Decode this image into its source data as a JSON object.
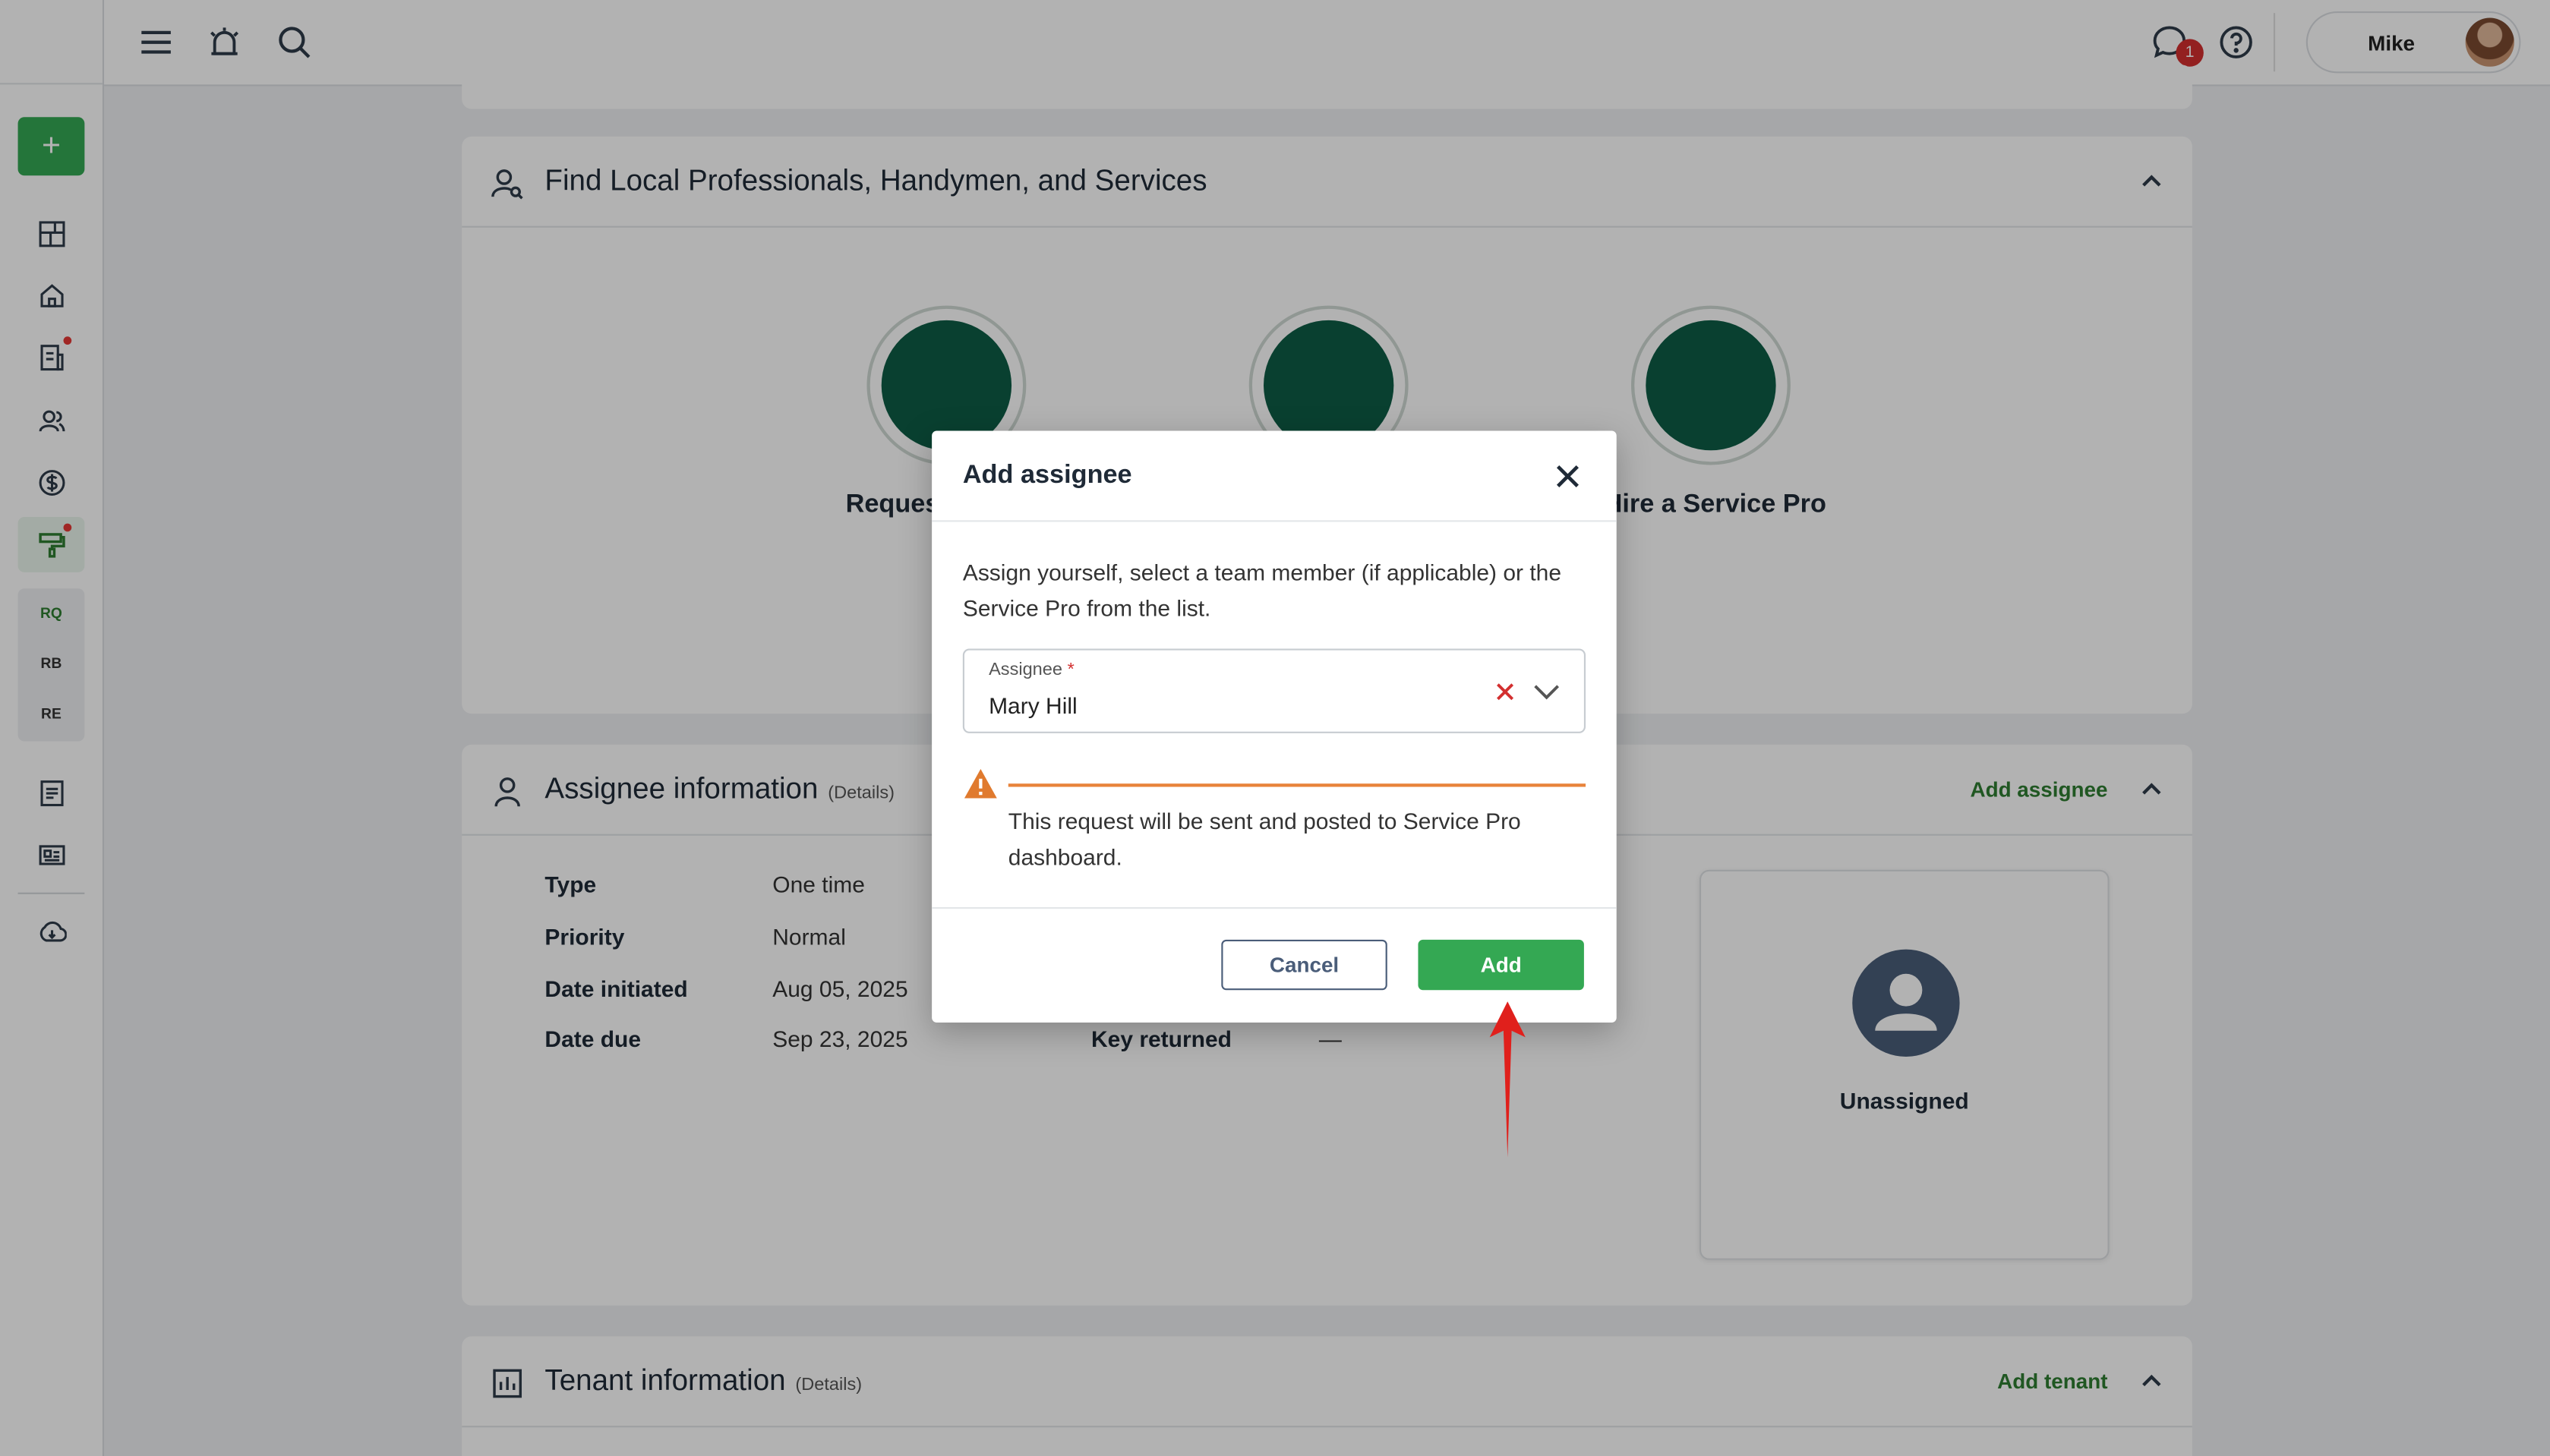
{
  "topbar": {
    "message_count": "1",
    "user_name": "Mike"
  },
  "sidebar": {
    "new_label": "+",
    "sub_items": [
      "RQ",
      "RB",
      "RE"
    ]
  },
  "find_pros": {
    "title": "Find Local Professionals, Handymen, and Services",
    "tile_left_label": "Reques",
    "tile_right_label": "Hire a Service Pro"
  },
  "assignee_info": {
    "title": "Assignee information",
    "details": "(Details)",
    "action": "Add assignee",
    "rows": [
      {
        "key": "Type",
        "value": "One time"
      },
      {
        "key": "Priority",
        "value": "Normal"
      },
      {
        "key": "Date initiated",
        "value": "Aug 05, 2025"
      },
      {
        "key": "Date due",
        "value": "Sep 23, 2025"
      }
    ],
    "key_returned_label": "Key returned",
    "key_returned_value": "—",
    "unassigned_label": "Unassigned"
  },
  "tenant_info": {
    "title": "Tenant information",
    "details": "(Details)",
    "action": "Add tenant"
  },
  "modal": {
    "title": "Add assignee",
    "description": "Assign yourself, select a team member (if applicable) or the Service Pro from the list.",
    "field_label": "Assignee",
    "field_required_mark": "*",
    "field_value": "Mary Hill",
    "warning": "This request will be sent and posted to Service Pro dashboard.",
    "cancel_label": "Cancel",
    "add_label": "Add"
  },
  "colors": {
    "accent_green": "#34a853",
    "text_green": "#2e7d32",
    "warning_orange": "#e8833a",
    "annotation_arrow": "#e0201c"
  }
}
